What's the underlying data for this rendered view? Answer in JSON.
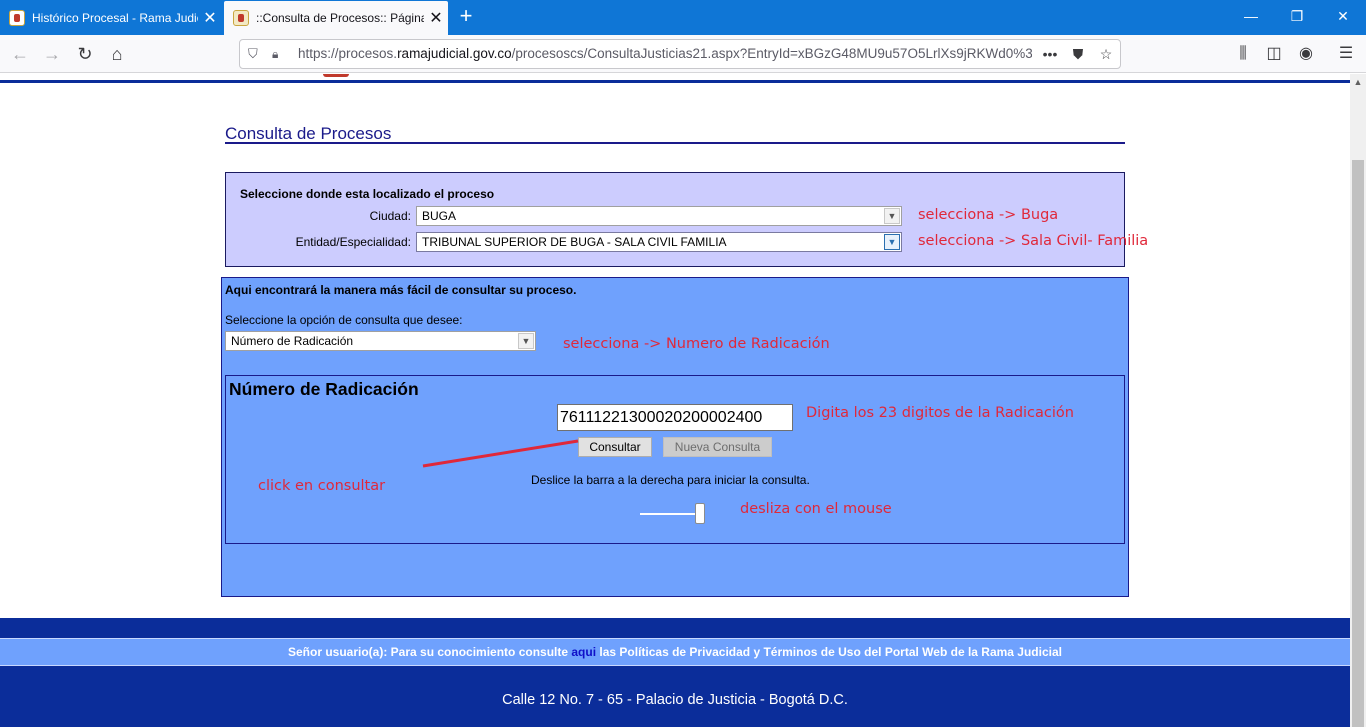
{
  "browser": {
    "tabs": [
      {
        "title": "Histórico Procesal - Rama Judic",
        "active": false
      },
      {
        "title": "::Consulta de Procesos:: Página",
        "active": true
      }
    ],
    "url_prefix": "https://procesos.",
    "url_domain": "ramajudicial.gov.co",
    "url_path": "/procesoscs/ConsultaJusticias21.aspx?EntryId=xBGzG48MU9u57O5LrlXs9jRKWd0%3",
    "accent_color": "#0f76d6"
  },
  "page": {
    "title": "Consulta de Procesos",
    "location": {
      "heading": "Seleccione donde esta localizado el proceso",
      "city_label": "Ciudad:",
      "city_value": "BUGA",
      "entity_label": "Entidad/Especialidad:",
      "entity_value": "TRIBUNAL SUPERIOR DE BUGA - SALA CIVIL FAMILIA"
    },
    "query": {
      "heading": "Aqui encontrará la manera más fácil de consultar su proceso.",
      "option_label": "Seleccione la opción de consulta que desee:",
      "option_value": "Número de Radicación",
      "radicacion_title": "Número de Radicación",
      "radicacion_value": "76111221300020200002400",
      "consultar_label": "Consultar",
      "nueva_label": "Nueva Consulta",
      "slide_hint": "Deslice la barra a la derecha para iniciar la consulta.",
      "slider_level": 1.0
    },
    "annotations": {
      "city": "selecciona -> Buga",
      "entity": "selecciona  -> Sala Civil- Familia",
      "option": "selecciona -> Numero de Radicación",
      "digits": "Digita los 23 digitos de la  Radicación",
      "click": "click en  consultar",
      "slide": "desliza con el mouse"
    },
    "footer": {
      "notice_before": "Señor usuario(a): Para su conocimiento consulte ",
      "notice_link": "aqui",
      "notice_after": " las Políticas de Privacidad y Términos de Uso del Portal Web de la Rama Judicial",
      "address": "Calle 12 No. 7 - 65 - Palacio de Justicia - Bogotá D.C."
    },
    "colors": {
      "location_bg": "#ccccfe",
      "query_bg": "#6fa1fd",
      "footer_bg": "#0b2d9a",
      "annotation": "#e0283a"
    }
  }
}
